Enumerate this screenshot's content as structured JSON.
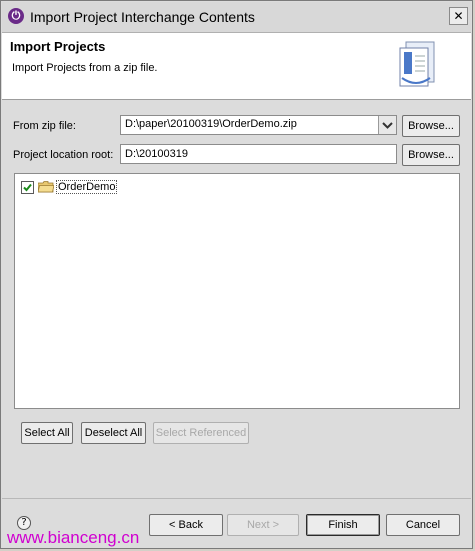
{
  "window": {
    "title": "Import Project Interchange Contents",
    "close_glyph": "✕"
  },
  "banner": {
    "title": "Import Projects",
    "description": "Import Projects from a zip file.",
    "icon": "import-wizard-icon"
  },
  "form": {
    "zip_label": "From zip file:",
    "zip_value": "D:\\paper\\20100319\\OrderDemo.zip",
    "zip_browse": "Browse...",
    "location_label": "Project location root:",
    "location_value": "D:\\20100319",
    "location_browse": "Browse..."
  },
  "tree": {
    "items": [
      {
        "label": "OrderDemo",
        "checked": true
      }
    ]
  },
  "selection_buttons": {
    "select_all": "Select All",
    "deselect_all": "Deselect All",
    "select_referenced": "Select Referenced"
  },
  "footer": {
    "help": "?",
    "back": "< Back",
    "next": "Next >",
    "finish": "Finish",
    "cancel": "Cancel"
  },
  "watermark": "www.bianceng.cn",
  "colors": {
    "watermark": "#d000d0",
    "app_icon": "#6a2a88"
  }
}
